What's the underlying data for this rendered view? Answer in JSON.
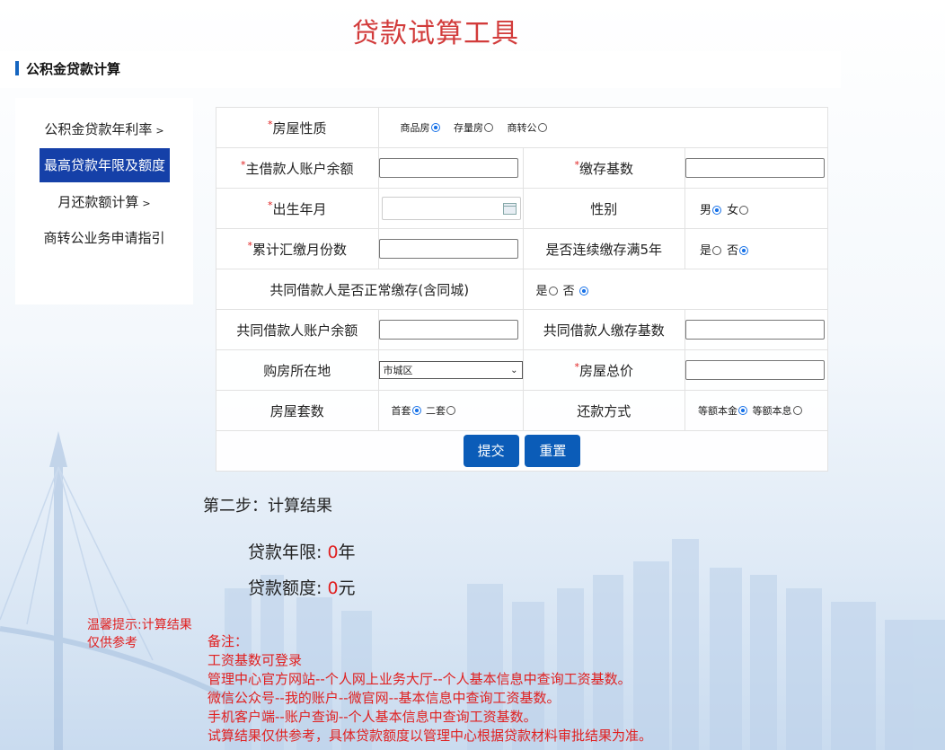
{
  "page_title": "贷款试算工具",
  "section_title": "公积金贷款计算",
  "sidebar": {
    "items": [
      {
        "label": "公积金贷款年利率",
        "arrow": ">"
      },
      {
        "label": "最高贷款年限及额度",
        "arrow": ""
      },
      {
        "label": "月还款额计算",
        "arrow": ">"
      },
      {
        "label": "商转公业务申请指引",
        "arrow": ""
      }
    ],
    "active_index": 1
  },
  "form": {
    "required_mark": "*",
    "house_type": {
      "label": "房屋性质",
      "options": [
        "商品房",
        "存量房",
        "商转公"
      ],
      "selected": "商品房"
    },
    "main_balance": {
      "label": "主借款人账户余额",
      "value": ""
    },
    "deposit_base": {
      "label": "缴存基数",
      "value": ""
    },
    "birth": {
      "label": "出生年月",
      "value": ""
    },
    "gender": {
      "label": "性别",
      "options": [
        "男",
        "女"
      ],
      "selected": "男"
    },
    "months": {
      "label": "累计汇缴月份数",
      "value": ""
    },
    "continuous": {
      "label": "是否连续缴存满5年",
      "options": [
        "是",
        "否"
      ],
      "selected": "否"
    },
    "co_normal": {
      "label": "共同借款人是否正常缴存(含同城)",
      "options": [
        "是",
        "否"
      ],
      "selected": "否"
    },
    "co_balance": {
      "label": "共同借款人账户余额",
      "value": ""
    },
    "co_base": {
      "label": "共同借款人缴存基数",
      "value": ""
    },
    "location": {
      "label": "购房所在地",
      "selected": "市城区"
    },
    "total_price": {
      "label": "房屋总价",
      "value": ""
    },
    "house_count": {
      "label": "房屋套数",
      "options": [
        "首套",
        "二套"
      ],
      "selected": "首套"
    },
    "repay_method": {
      "label": "还款方式",
      "options": [
        "等额本金",
        "等额本息"
      ],
      "selected": "等额本金"
    },
    "submit_label": "提交",
    "reset_label": "重置"
  },
  "result": {
    "heading": "第二步：计算结果",
    "years_label": "贷款年限: ",
    "years_value": "0",
    "years_unit": "年",
    "amount_label": "贷款额度: ",
    "amount_value": "0",
    "amount_unit": "元"
  },
  "tip": "温馨提示:计算结果仅供参考",
  "notes": [
    "备注：",
    "工资基数可登录",
    "管理中心官方网站--个人网上业务大厅--个人基本信息中查询工资基数。",
    "微信公众号--我的账户--微官网--基本信息中查询工资基数。",
    "手机客户端--账户查询--个人基本信息中查询工资基数。",
    "试算结果仅供参考，具体贷款额度以管理中心根据贷款材料审批结果为准。"
  ]
}
